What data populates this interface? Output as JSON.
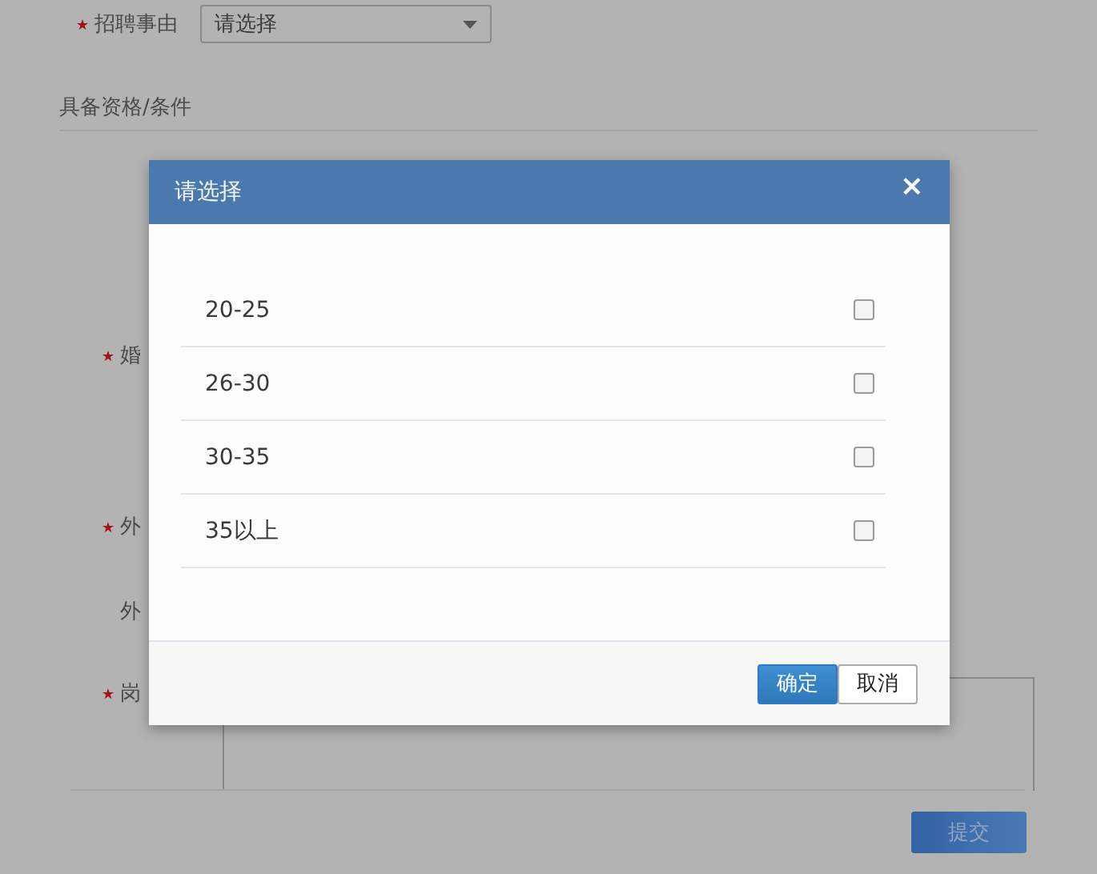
{
  "form": {
    "reason": {
      "label": "招聘事由",
      "required": true,
      "value": "请选择"
    },
    "section_title": "具备资格/条件",
    "fields": [
      {
        "label": "婚",
        "required": true
      },
      {
        "label": "外",
        "required": true
      },
      {
        "label": "外",
        "required": false
      },
      {
        "label": "岗",
        "required": true
      }
    ],
    "submit": "提交"
  },
  "dialog": {
    "title": "请选择",
    "close": "×",
    "options": [
      {
        "label": "20-25",
        "checked": false
      },
      {
        "label": "26-30",
        "checked": false
      },
      {
        "label": "30-35",
        "checked": false
      },
      {
        "label": "35以上",
        "checked": false
      }
    ],
    "buttons": [
      {
        "label": "确定",
        "kind": "primary"
      },
      {
        "label": "取消",
        "kind": "default"
      }
    ]
  }
}
